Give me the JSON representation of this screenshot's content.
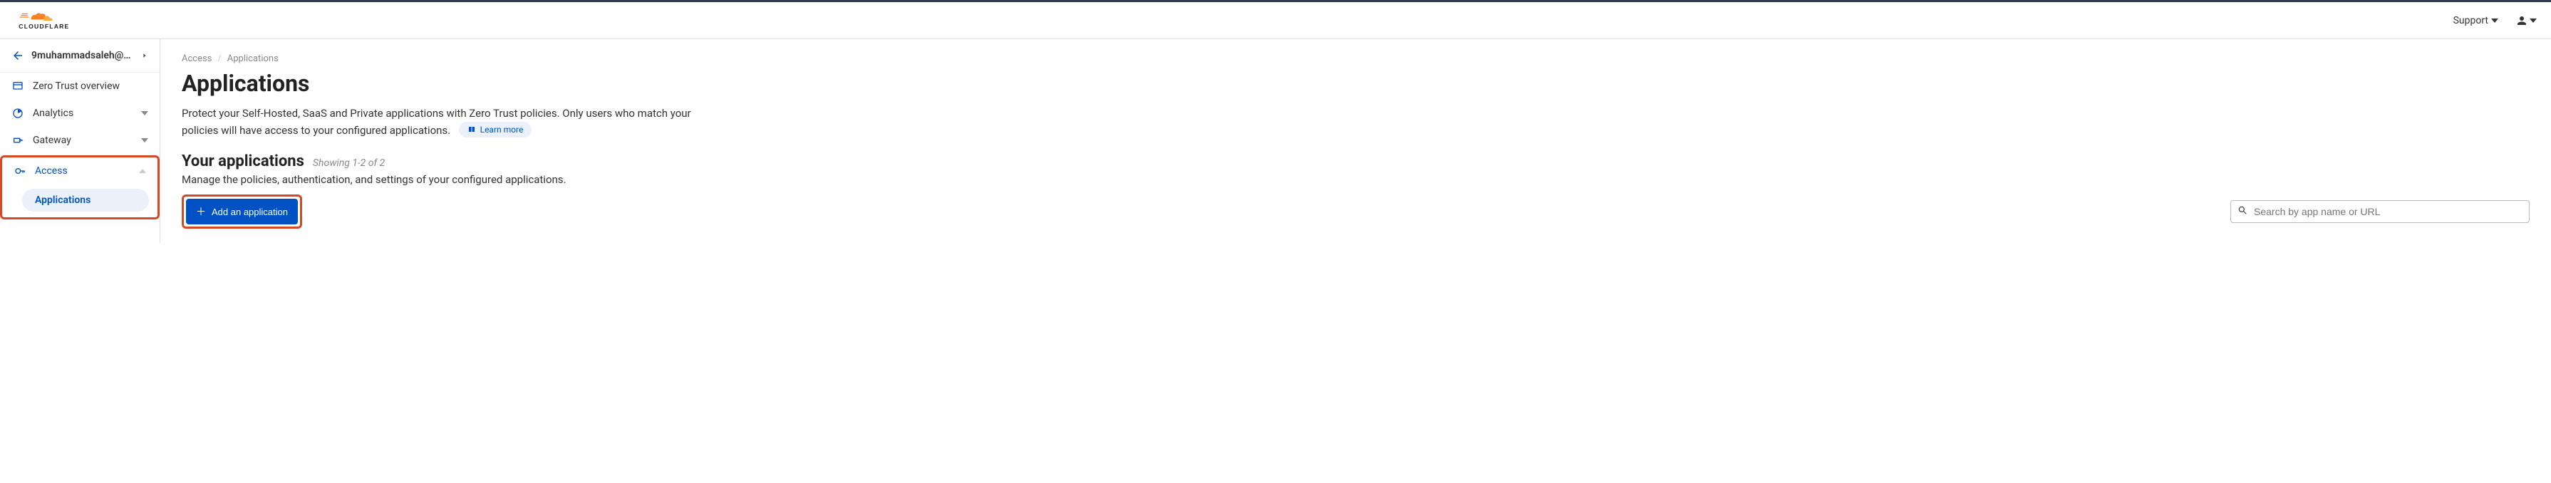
{
  "topbar": {
    "support_label": "Support"
  },
  "sidebar": {
    "back_icon": "←",
    "account_name": "9muhammadsaleh@g...",
    "chevron": "▸",
    "items": [
      {
        "label": "Zero Trust overview"
      },
      {
        "label": "Analytics"
      },
      {
        "label": "Gateway"
      },
      {
        "label": "Access"
      }
    ],
    "subitem": {
      "label": "Applications"
    }
  },
  "breadcrumb": {
    "parent": "Access",
    "sep": "/",
    "current": "Applications"
  },
  "page": {
    "title": "Applications",
    "description": "Protect your Self-Hosted, SaaS and Private applications with Zero Trust policies. Only users who match your policies will have access to your configured applications.",
    "learn_more": "Learn more"
  },
  "section": {
    "title": "Your applications",
    "showing": "Showing 1-2 of 2",
    "description": "Manage the policies, authentication, and settings of your configured applications.",
    "add_button": "Add an application",
    "search_placeholder": "Search by app name or URL"
  }
}
